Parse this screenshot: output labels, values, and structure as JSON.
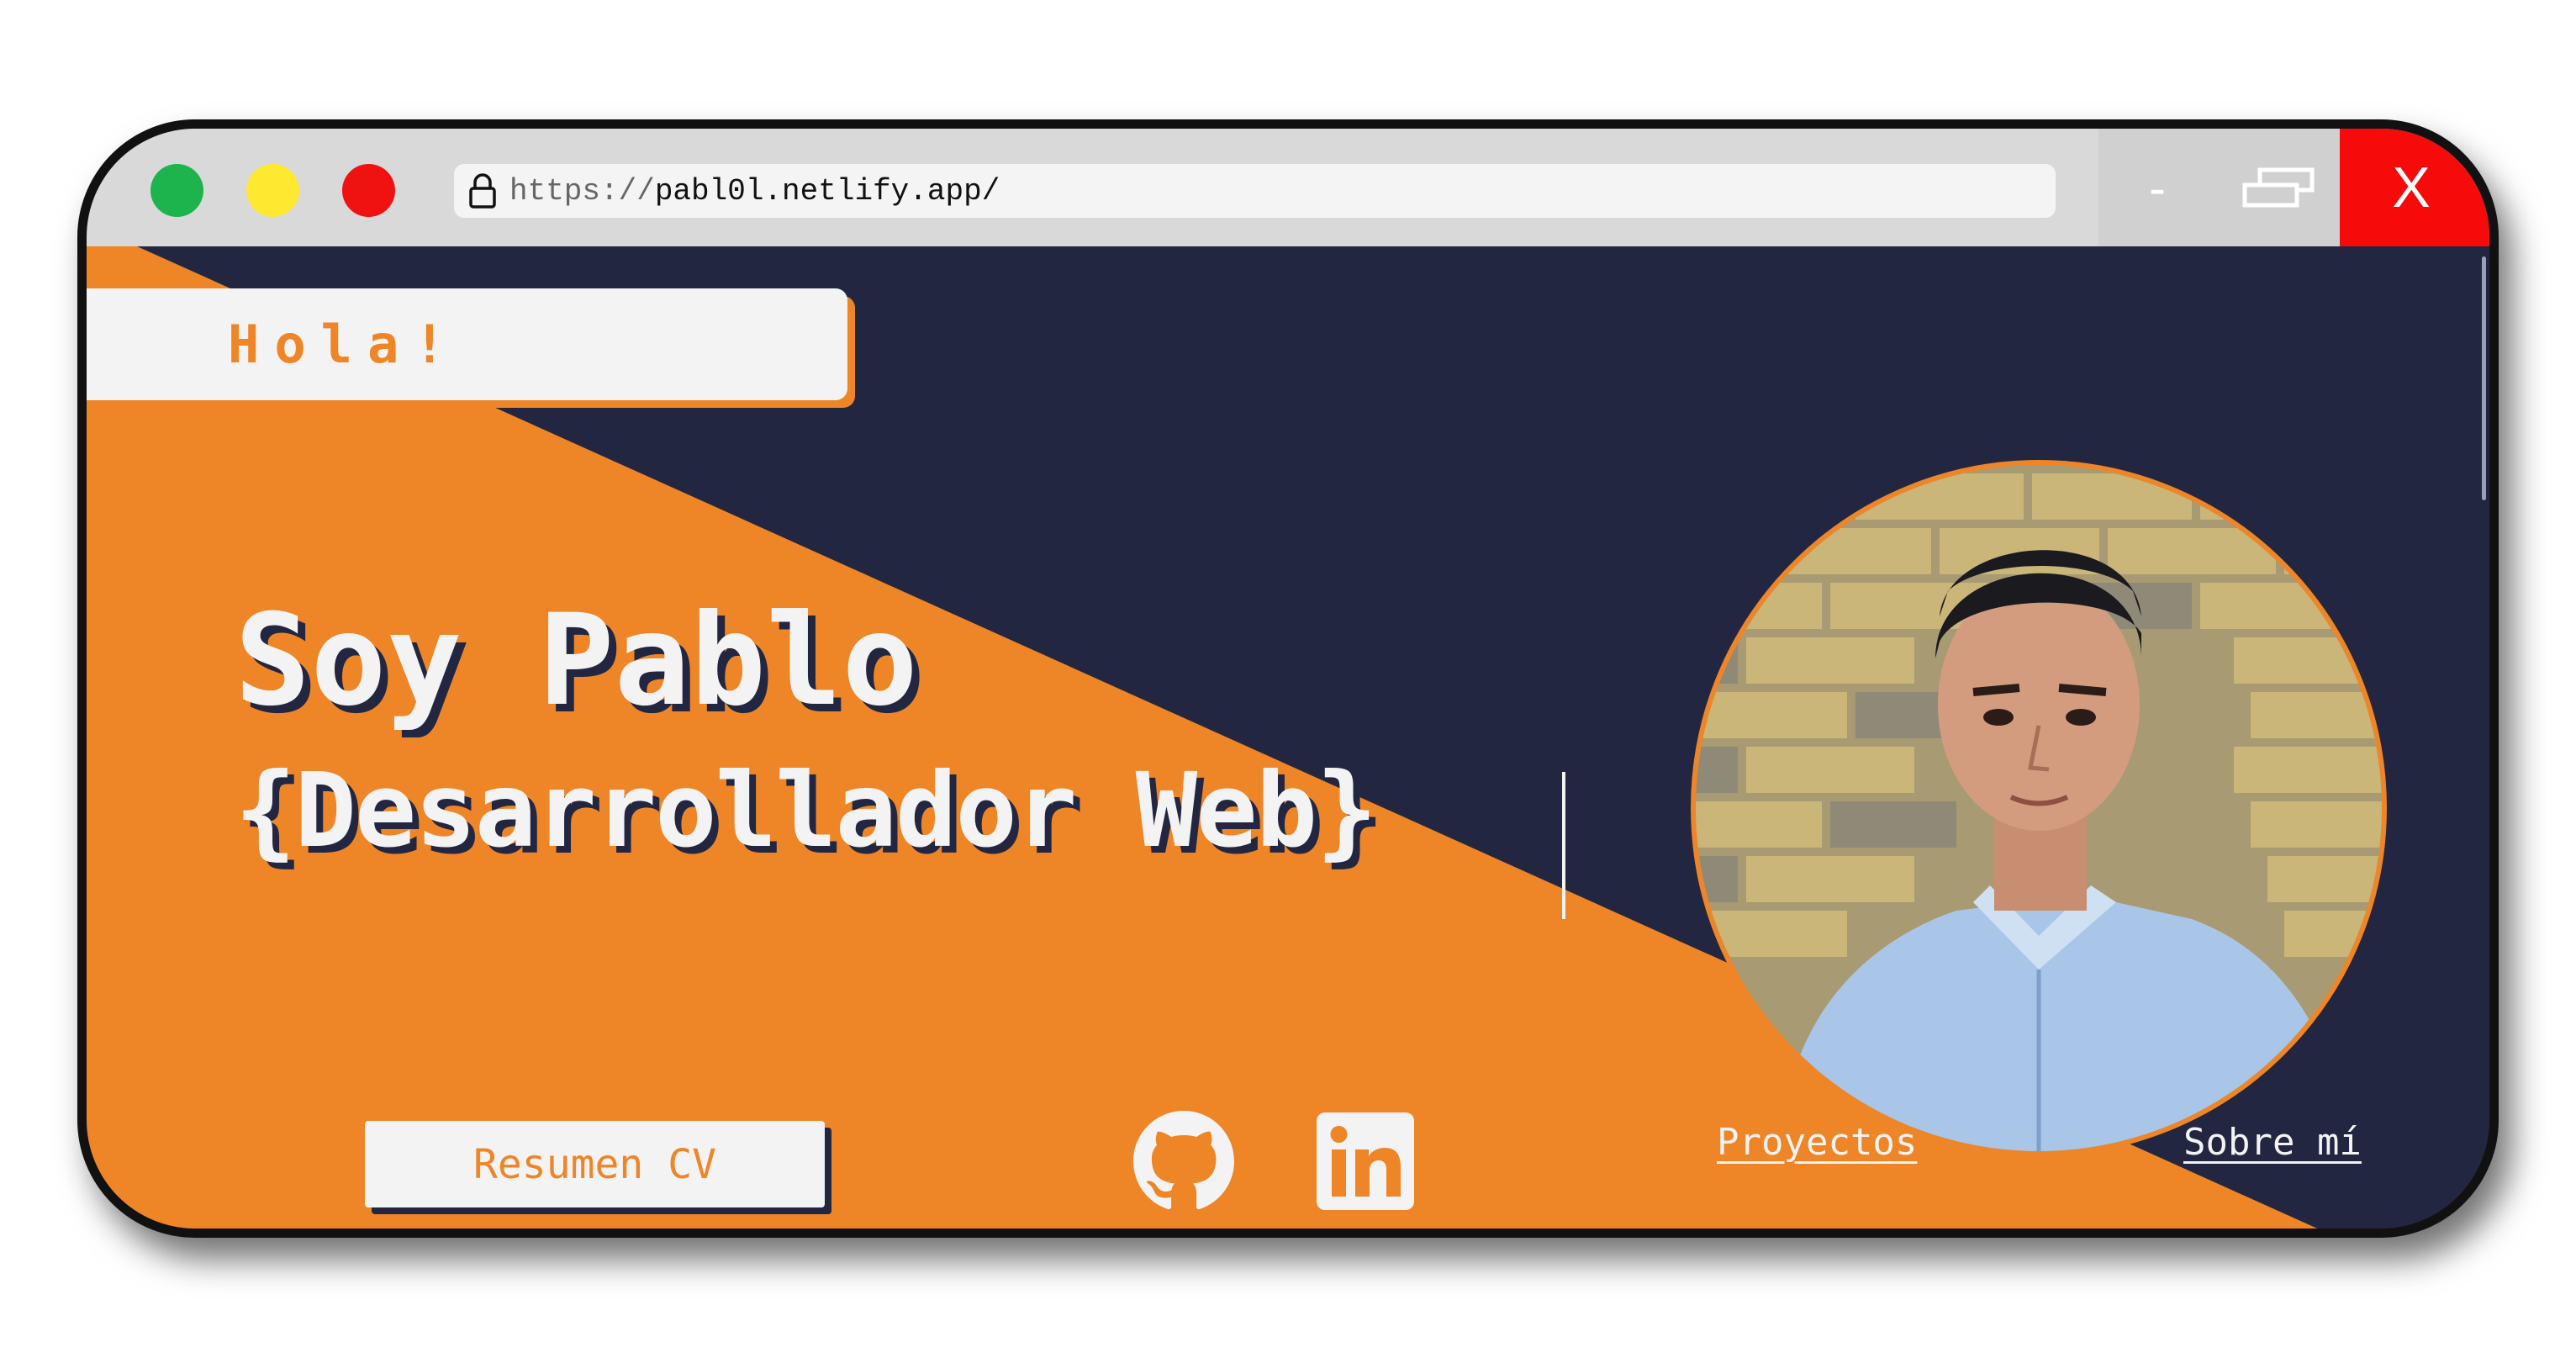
{
  "window": {
    "url_scheme": "https://",
    "url_host": "pabl0l.netlify.app/",
    "controls": {
      "minimize_label": "-",
      "close_label": "X"
    },
    "traffic_lights": [
      "green",
      "yellow",
      "red"
    ]
  },
  "hero": {
    "greeting": "Hola!",
    "name_line": "Soy Pablo",
    "role_line": "{Desarrollador Web}"
  },
  "actions": {
    "cv_button_label": "Resumen CV",
    "social": [
      {
        "icon": "github-icon"
      },
      {
        "icon": "linkedin-icon"
      }
    ],
    "nav": [
      {
        "label": "Proyectos"
      },
      {
        "label": "Sobre mí"
      }
    ]
  },
  "colors": {
    "navy": "#222640",
    "orange": "#ee8527",
    "off_white": "#f3f3f3",
    "close_red": "#f60a0a"
  }
}
